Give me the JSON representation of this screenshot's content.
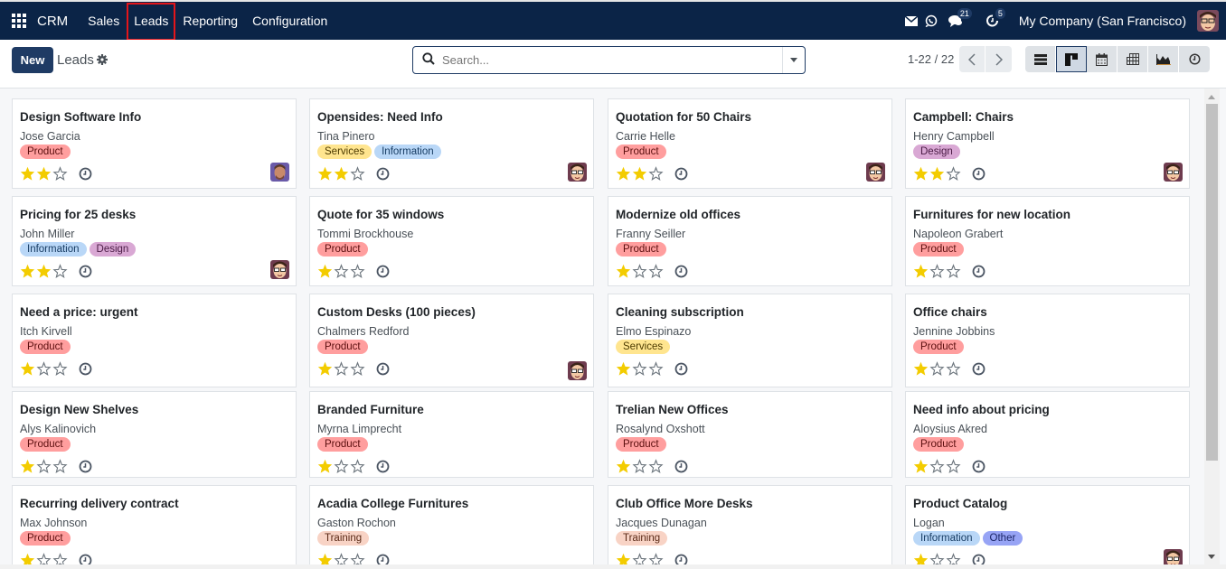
{
  "navbar": {
    "app_name": "CRM",
    "menu": [
      "Sales",
      "Leads",
      "Reporting",
      "Configuration"
    ],
    "highlighted_menu": "Leads",
    "messages_badge": "21",
    "activities_badge": "5",
    "company": "My Company (San Francisco)"
  },
  "control": {
    "new_label": "New",
    "breadcrumb": "Leads",
    "search_placeholder": "Search...",
    "search_value": "",
    "pager": "1-22 / 22",
    "views": [
      "list",
      "kanban",
      "calendar",
      "pivot",
      "graph",
      "activity"
    ],
    "active_view": "kanban"
  },
  "tag_colors": {
    "Product": {
      "bg": "#ff9e9e",
      "fg": "#5c0f0f"
    },
    "Services": {
      "bg": "#ffe58f",
      "fg": "#4d3b00"
    },
    "Information": {
      "bg": "#b9d7f7",
      "fg": "#173c63"
    },
    "Design": {
      "bg": "#d9a8d4",
      "fg": "#4a1b45"
    },
    "Training": {
      "bg": "#f8d3c5",
      "fg": "#5a2a17"
    },
    "Other": {
      "bg": "#97a4f5",
      "fg": "#1a2466"
    }
  },
  "cards": [
    {
      "title": "Design Software Info",
      "contact": "Jose Garcia",
      "tags": [
        "Product"
      ],
      "stars": 2,
      "avatar": "man"
    },
    {
      "title": "Opensides: Need Info",
      "contact": "Tina Pinero",
      "tags": [
        "Services",
        "Information"
      ],
      "stars": 2,
      "avatar": "cartoon"
    },
    {
      "title": "Quotation for 50 Chairs",
      "contact": "Carrie Helle",
      "tags": [
        "Product"
      ],
      "stars": 2,
      "avatar": "cartoon"
    },
    {
      "title": "Campbell: Chairs",
      "contact": "Henry Campbell",
      "tags": [
        "Design"
      ],
      "stars": 2,
      "avatar": "cartoon"
    },
    {
      "title": "Pricing for 25 desks",
      "contact": "John Miller",
      "tags": [
        "Information",
        "Design"
      ],
      "stars": 2,
      "avatar": "cartoon"
    },
    {
      "title": "Quote for 35 windows",
      "contact": "Tommi Brockhouse",
      "tags": [
        "Product"
      ],
      "stars": 1,
      "avatar": null
    },
    {
      "title": "Modernize old offices",
      "contact": "Franny Seiller",
      "tags": [
        "Product"
      ],
      "stars": 1,
      "avatar": null
    },
    {
      "title": "Furnitures for new location",
      "contact": "Napoleon Grabert",
      "tags": [
        "Product"
      ],
      "stars": 1,
      "avatar": null
    },
    {
      "title": "Need a price: urgent",
      "contact": "Itch Kirvell",
      "tags": [
        "Product"
      ],
      "stars": 1,
      "avatar": null
    },
    {
      "title": "Custom Desks (100 pieces)",
      "contact": "Chalmers Redford",
      "tags": [
        "Product"
      ],
      "stars": 1,
      "avatar": "cartoon"
    },
    {
      "title": "Cleaning subscription",
      "contact": "Elmo Espinazo",
      "tags": [
        "Services"
      ],
      "stars": 1,
      "avatar": null
    },
    {
      "title": "Office chairs",
      "contact": "Jennine Jobbins",
      "tags": [
        "Product"
      ],
      "stars": 1,
      "avatar": null
    },
    {
      "title": "Design New Shelves",
      "contact": "Alys Kalinovich",
      "tags": [
        "Product"
      ],
      "stars": 1,
      "avatar": null
    },
    {
      "title": "Branded Furniture",
      "contact": "Myrna Limprecht",
      "tags": [
        "Product"
      ],
      "stars": 1,
      "avatar": null
    },
    {
      "title": "Trelian New Offices",
      "contact": "Rosalynd Oxshott",
      "tags": [
        "Product"
      ],
      "stars": 1,
      "avatar": null
    },
    {
      "title": "Need info about pricing",
      "contact": "Aloysius Akred",
      "tags": [
        "Product"
      ],
      "stars": 1,
      "avatar": null
    },
    {
      "title": "Recurring delivery contract",
      "contact": "Max Johnson",
      "tags": [
        "Product"
      ],
      "stars": 1,
      "avatar": null
    },
    {
      "title": "Acadia College Furnitures",
      "contact": "Gaston Rochon",
      "tags": [
        "Training"
      ],
      "stars": 1,
      "avatar": null
    },
    {
      "title": "Club Office More Desks",
      "contact": "Jacques Dunagan",
      "tags": [
        "Training"
      ],
      "stars": 1,
      "avatar": null
    },
    {
      "title": "Product Catalog",
      "contact": "Logan",
      "tags": [
        "Information",
        "Other"
      ],
      "stars": 1,
      "avatar": "cartoon"
    }
  ]
}
